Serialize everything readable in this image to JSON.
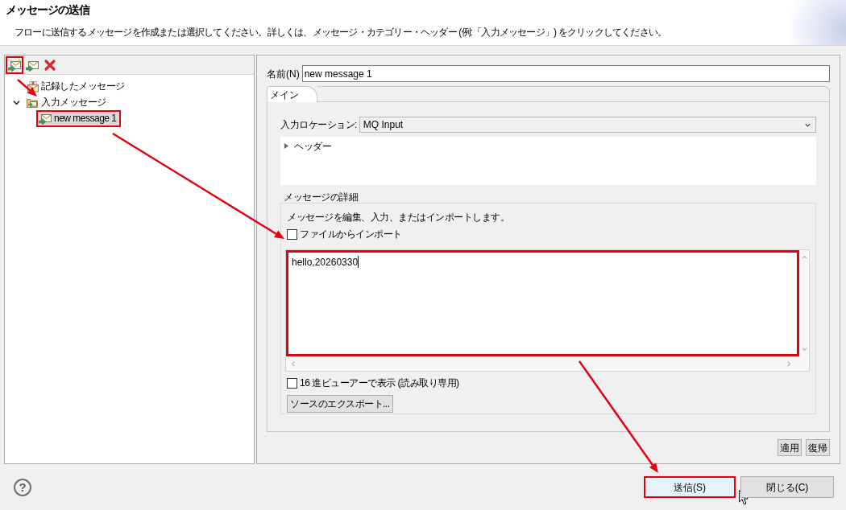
{
  "dialog": {
    "title": "メッセージの送信",
    "description": "フローに送信するメッセージを作成または選択してください。詳しくは、メッセージ・カテゴリー・ヘッダー (例:「入力メッセージ」) をクリックしてください。"
  },
  "toolbar": [
    {
      "kind": "new",
      "highlighted": true
    },
    {
      "kind": "copy",
      "highlighted": false
    },
    {
      "kind": "delete",
      "highlighted": false
    }
  ],
  "tree": [
    {
      "label": "記録したメッセージ",
      "kind": "recorded",
      "selected": false,
      "highlighted": false
    },
    {
      "label": "入力メッセージ",
      "kind": "folder",
      "expanded": true,
      "selected": false,
      "highlighted": false,
      "children": [
        {
          "label": "new message 1",
          "kind": "message",
          "selected": true,
          "highlighted": true
        }
      ]
    }
  ],
  "name_field": {
    "label": "名前(N)",
    "value": "new message 1"
  },
  "tabs": [
    {
      "label": "メイン",
      "selected": true
    }
  ],
  "input_location": {
    "label": "入力ロケーション:",
    "value": "MQ Input"
  },
  "headers": {
    "label": "ヘッダー",
    "expanded": false
  },
  "message_details": {
    "title": "メッセージの詳細",
    "description": "メッセージを編集、入力、またはインポートします。",
    "import_from_file": {
      "label": "ファイルからインポート",
      "checked": false
    },
    "content": {
      "value": "hello,20260330",
      "highlighted": true
    },
    "hex_viewer": {
      "label": "16 進ビューアーで表示 (読み取り専用)",
      "checked": false
    },
    "export_button": "ソースのエクスポート..."
  },
  "panel_buttons": [
    {
      "label": "適用"
    },
    {
      "label": "復帰"
    }
  ],
  "help": {
    "glyph": "?"
  },
  "dialog_buttons": [
    {
      "label": "送信(S)",
      "hovered": true,
      "highlighted": true
    },
    {
      "label": "閉じる(C)",
      "hovered": false,
      "highlighted": false
    }
  ]
}
